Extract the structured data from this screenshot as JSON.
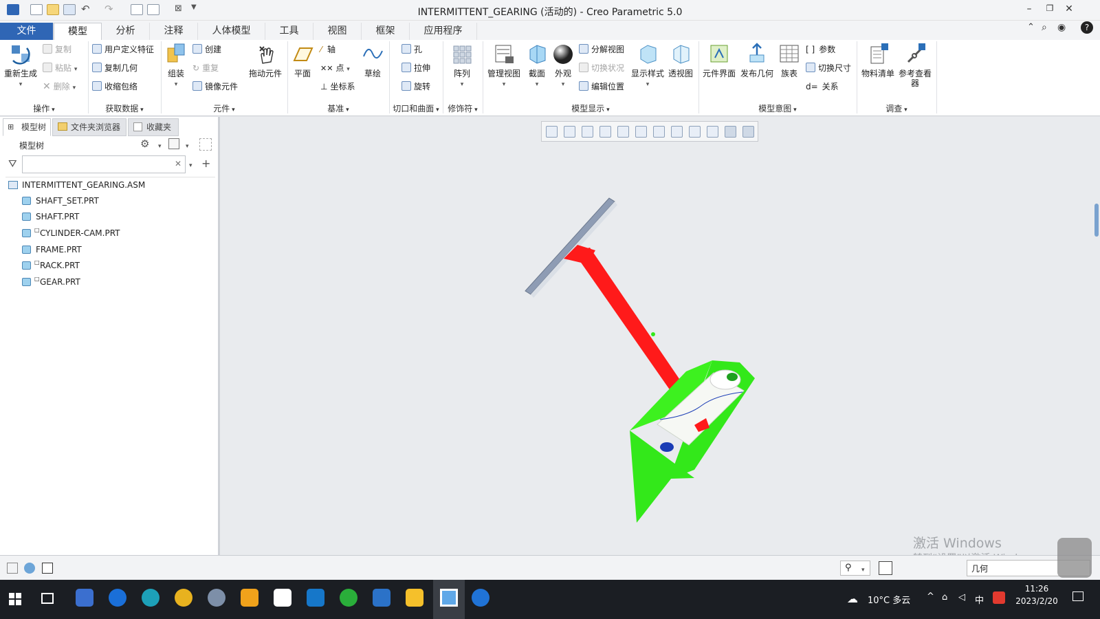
{
  "window": {
    "title": "INTERMITTENT_GEARING (活动的) - Creo Parametric 5.0"
  },
  "tabs": [
    "文件",
    "模型",
    "分析",
    "注释",
    "人体模型",
    "工具",
    "视图",
    "框架",
    "应用程序"
  ],
  "ribbon": {
    "ops": {
      "regen": "重新生成",
      "copy": "复制",
      "paste": "粘贴",
      "delete": "删除",
      "label": "操作"
    },
    "getdata": {
      "udf": "用户定义特征",
      "copygeom": "复制几何",
      "shrinkwrap": "收缩包络",
      "label": "获取数据"
    },
    "component": {
      "assemble": "组装",
      "create": "创建",
      "repeat": "重复",
      "mirror": "镜像元件",
      "drag": "拖动元件",
      "label": "元件"
    },
    "datum": {
      "plane": "平面",
      "axis": "轴",
      "point": "点",
      "csys": "坐标系",
      "sketch": "草绘",
      "label": "基准"
    },
    "cut": {
      "hole": "孔",
      "extrude": "拉伸",
      "revolve": "旋转",
      "label": "切口和曲面"
    },
    "modifier": {
      "pattern": "阵列",
      "label": "修饰符"
    },
    "display": {
      "manage": "管理视图",
      "section": "截面",
      "appearance": "外观",
      "explode": "分解视图",
      "toggle": "切换状况",
      "editpos": "编辑位置",
      "style": "显示样式",
      "perspective": "透视图",
      "label": "模型显示"
    },
    "intent": {
      "interface": "元件界面",
      "publish": "发布几何",
      "family": "族表",
      "params": "参数",
      "switchdim": "切换尺寸",
      "relations": "关系",
      "label": "模型意图"
    },
    "investigate": {
      "bom": "物料清单",
      "refviewer": "参考查看器",
      "label": "调查"
    }
  },
  "panel": {
    "tabs": [
      "模型树",
      "文件夹浏览器",
      "收藏夹"
    ],
    "header": "模型树",
    "search_placeholder": ""
  },
  "tree": {
    "root": "INTERMITTENT_GEARING.ASM",
    "items": [
      "SHAFT_SET.PRT",
      "SHAFT.PRT",
      "CYLINDER-CAM.PRT",
      "FRAME.PRT",
      "RACK.PRT",
      "GEAR.PRT"
    ]
  },
  "status": {
    "filter": "几何"
  },
  "watermark": {
    "line1": "激活 Windows",
    "line2": "转到“设置”以激活 Windows。"
  },
  "taskbar": {
    "weather": "10°C 多云",
    "clock_time": "11:26",
    "clock_date": "2023/2/20",
    "ime": "中"
  }
}
